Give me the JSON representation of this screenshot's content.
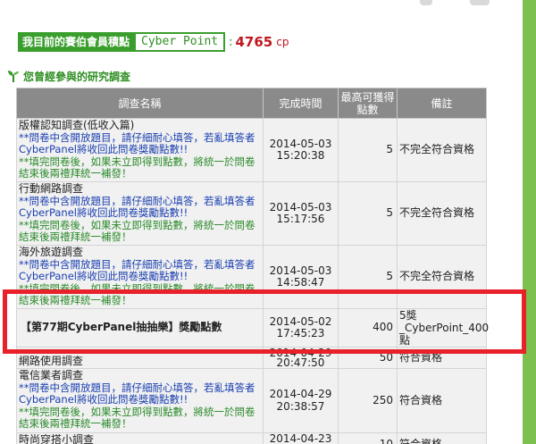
{
  "points": {
    "label": "我目前的賽伯會員積點",
    "brand": "Cyber Point",
    "colon": ":",
    "value": "4765",
    "unit": "cp"
  },
  "section": {
    "title": "您曾經參與的研究調查",
    "icon": "sprout-icon"
  },
  "table": {
    "headers": {
      "name": "調查名稱",
      "time": "完成時間",
      "points": "最高可獲得點數",
      "note": "備註"
    },
    "rows": [
      {
        "title": "版權認知調查(低收入篇)",
        "note1": "**問卷中含開放題目，請仔細耐心填答，若亂填答者CyberPanel將收回此問卷獎勵點數!!",
        "note2": "**填完問卷後，如果未立即得到點數，將統一於問卷結束後兩禮拜統一補發！",
        "date": "2014-05-03",
        "clock": "15:20:38",
        "points": "5",
        "remark": "不完全符合資格"
      },
      {
        "title": "行動網路調查",
        "note1": "**問卷中含開放題目，請仔細耐心填答，若亂填答者CyberPanel將收回此問卷獎勵點數!!",
        "note2": "**填完問卷後，如果未立即得到點數，將統一於問卷結束後兩禮拜統一補發！",
        "date": "2014-05-03",
        "clock": "15:17:56",
        "points": "5",
        "remark": "不完全符合資格"
      },
      {
        "title": "海外旅遊調查",
        "note1": "**問卷中含開放題目，請仔細耐心填答，若亂填答者CyberPanel將收回此問卷獎勵點數!!",
        "note2": "**填完問卷後，如果未立即得到點數，將統一於問卷結束後兩禮拜統一補發！",
        "date": "2014-05-03",
        "clock": "14:58:47",
        "points": "5",
        "remark": "不完全符合資格"
      },
      {
        "bold": "【第77期CyberPanel抽抽樂】獎勵點數",
        "date": "2014-05-02",
        "clock": "17:45:23",
        "points": "400",
        "remark": "5獎_CyberPoint_400點"
      },
      {
        "title": "網路使用調查",
        "date": "2014-04-29",
        "clock": "20:47:50",
        "points": "50",
        "remark": "符合資格"
      },
      {
        "title": "電信業者調查",
        "note1": "**問卷中含開放題目，請仔細耐心填答，若亂填答者CyberPanel將收回此問卷獎勵點數!!",
        "note2": "**填完問卷後，如果未立即得到點數，將統一於問卷結束後兩禮拜統一補發！",
        "date": "2014-04-29",
        "clock": "20:38:57",
        "points": "250",
        "remark": "符合資格"
      },
      {
        "title": "時尚穿搭小調查",
        "date": "2014-04-23",
        "points": "10",
        "remark": "符合資格"
      }
    ]
  }
}
